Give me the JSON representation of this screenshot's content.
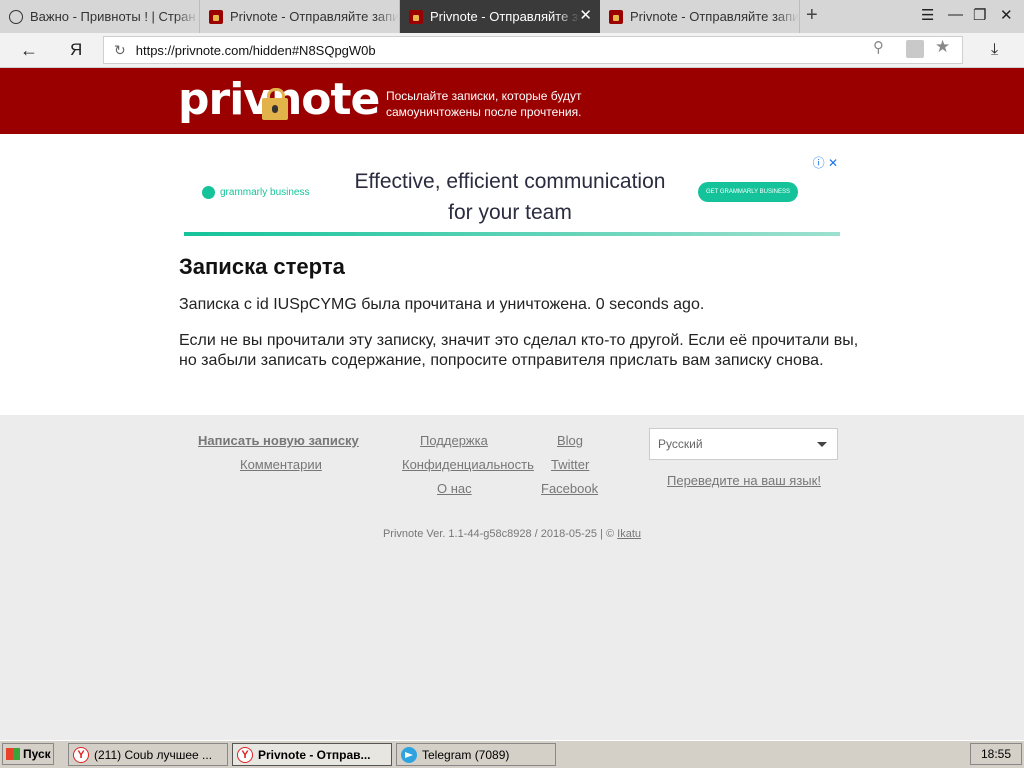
{
  "browser": {
    "tabs": [
      {
        "title": "Важно - Привноты ! | Стран"
      },
      {
        "title": "Privnote - Отправляйте записи"
      },
      {
        "title": "Privnote - Отправляйте за"
      },
      {
        "title": "Privnote - Отправляйте записи"
      }
    ],
    "new_tab_glyph": "+",
    "url": "https://privnote.com/hidden#N8SQpgW0b",
    "yandex_glyph": "Я"
  },
  "site": {
    "logo_text": "privnote",
    "tagline": "Посылайте записки, которые будут самоуничтожены после прочтения.",
    "brand_color": "#9a0000"
  },
  "ad": {
    "brand": "grammarly business",
    "headline": "Effective, efficient communication for your team",
    "cta": "GET GRAMMARLY BUSINESS",
    "accent_color": "#15c39a"
  },
  "note": {
    "title": "Записка стерта",
    "destroyed_message": "Записка с id IUSpCYMG была прочитана и уничтожена. 0 seconds ago.",
    "warning": "Если не вы прочитали эту записку, значит это сделал кто-то другой. Если её прочитали вы, но забыли записать содержание, попросите отправителя прислать вам записку снова."
  },
  "footer": {
    "new_note": "Написать новую записку",
    "comments": "Комментарии",
    "support": "Поддержка",
    "privacy": "Конфиденциальность",
    "about": "О нас",
    "blog": "Blog",
    "twitter": "Twitter",
    "facebook": "Facebook",
    "language_selected": "Русский",
    "translate_link": "Переведите на ваш язык!",
    "version_text": "Privnote Ver. 1.1-44-g58c8928 / 2018-05-25 | ©",
    "author": "Ikatu"
  },
  "taskbar": {
    "start_label": "Пуск",
    "tasks": [
      {
        "label": "(211) Coub лучшее ..."
      },
      {
        "label": "Privnote - Отправ..."
      },
      {
        "label": "Telegram (7089)"
      }
    ],
    "clock": "18:55"
  }
}
